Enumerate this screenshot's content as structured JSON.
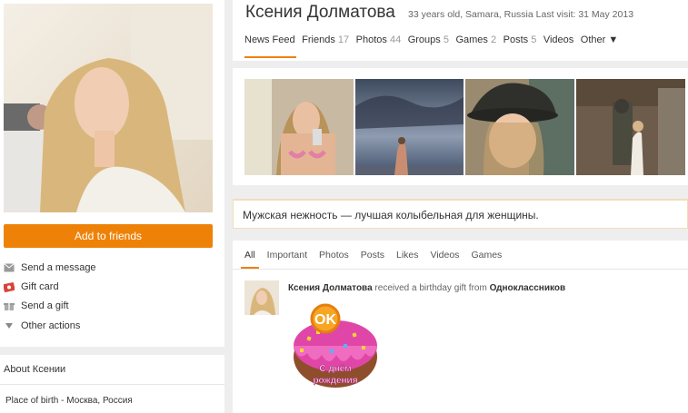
{
  "profile": {
    "name": "Ксения Долматова",
    "meta": "33 years old, Samara, Russia  Last visit: 31 May 2013",
    "add_friend": "Add to friends",
    "status": "Мужская нежность — лучшая колыбельная для женщины."
  },
  "actions": [
    {
      "label": "Send a message",
      "icon": "envelope-icon"
    },
    {
      "label": "Gift card",
      "icon": "gift-card-icon"
    },
    {
      "label": "Send a gift",
      "icon": "gift-icon"
    },
    {
      "label": "Other actions",
      "icon": "triangle-down-icon"
    }
  ],
  "about": {
    "title": "About Ксении",
    "place_of_birth": "Place of birth - Москва, Россия"
  },
  "nav": [
    {
      "label": "News Feed",
      "count": ""
    },
    {
      "label": "Friends",
      "count": "17"
    },
    {
      "label": "Photos",
      "count": "44"
    },
    {
      "label": "Groups",
      "count": "5"
    },
    {
      "label": "Games",
      "count": "2"
    },
    {
      "label": "Posts",
      "count": "5"
    },
    {
      "label": "Videos",
      "count": ""
    },
    {
      "label": "Other ▼",
      "count": ""
    }
  ],
  "feed": {
    "tabs": [
      "All",
      "Important",
      "Photos",
      "Posts",
      "Likes",
      "Videos",
      "Games"
    ],
    "event": {
      "actor": "Ксения Долматова",
      "text": "received a birthday gift from",
      "source": "Одноклассников"
    },
    "gift": {
      "logo": "OK",
      "caption1": "С днём",
      "caption2": "рождения"
    }
  },
  "colors": {
    "accent": "#ee8208",
    "status_border": "#f3dcbb"
  }
}
